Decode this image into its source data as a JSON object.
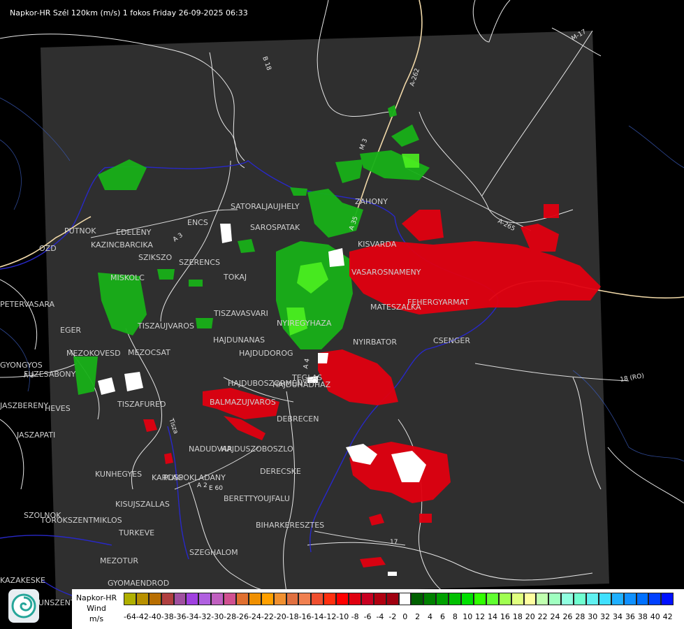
{
  "header": {
    "title": "Napkor-HR Szél 120km (m/s) 1 fokos Friday 26-09-2025 06:33"
  },
  "map": {
    "places": [
      {
        "name": "SATORALJAUJHELY"
      },
      {
        "name": "SAROSPATAK"
      },
      {
        "name": "ZAHONY"
      },
      {
        "name": "KISVARDA"
      },
      {
        "name": "VASAROSNAMENY"
      },
      {
        "name": "FEHERGYARMAT"
      },
      {
        "name": "MATESZALKA"
      },
      {
        "name": "CSENGER"
      },
      {
        "name": "NYIRBATOR"
      },
      {
        "name": "PUTNOK"
      },
      {
        "name": "EDELENY"
      },
      {
        "name": "KAZINCBARCIKA"
      },
      {
        "name": "SZIKSZO"
      },
      {
        "name": "ENCS"
      },
      {
        "name": "SZERENCS"
      },
      {
        "name": "MISKOLC"
      },
      {
        "name": "TOKAJ"
      },
      {
        "name": "OZD"
      },
      {
        "name": "PETERVASARA"
      },
      {
        "name": "EGER"
      },
      {
        "name": "MEZOKOVESD"
      },
      {
        "name": "MEZOCSAT"
      },
      {
        "name": "TISZAUJVAROS"
      },
      {
        "name": "TISZAVASVARI"
      },
      {
        "name": "HAJDUNANAS"
      },
      {
        "name": "HAJDUDOROG"
      },
      {
        "name": "HAJDUBOSZORMENY"
      },
      {
        "name": "HAJDUHADHAZ"
      },
      {
        "name": "TEGLAS"
      },
      {
        "name": "BALMAZUJVAROS"
      },
      {
        "name": "DEBRECEN"
      },
      {
        "name": "GYONGYOS"
      },
      {
        "name": "FUZESABONY"
      },
      {
        "name": "HEVES"
      },
      {
        "name": "TISZAFURED"
      },
      {
        "name": "JASZAPATI"
      },
      {
        "name": "JASZBERENY"
      },
      {
        "name": "NADUDVAR"
      },
      {
        "name": "HAJDUSZOBOSZLO"
      },
      {
        "name": "KUNHEGYES"
      },
      {
        "name": "KARCAG"
      },
      {
        "name": "PUSPOKLADANY"
      },
      {
        "name": "DERECSKE"
      },
      {
        "name": "BERETTYOUJFALU"
      },
      {
        "name": "KISUJSZALLAS"
      },
      {
        "name": "SZOLNOK"
      },
      {
        "name": "TOROKSZENTMIKLOS"
      },
      {
        "name": "TURKEVE"
      },
      {
        "name": "BIHARKERESZTES"
      },
      {
        "name": "SZEGHALOM"
      },
      {
        "name": "MEZOTUR"
      },
      {
        "name": "GYOMAENDROD"
      },
      {
        "name": "KUNSZENTMARTON"
      },
      {
        "name": "KAZAKESKE"
      },
      {
        "name": "NYIREGYHAZA"
      }
    ],
    "roads": [
      {
        "label": "B 18"
      },
      {
        "label": "A-262"
      },
      {
        "label": "A-265"
      },
      {
        "label": "M-17"
      },
      {
        "label": "18 (RO)"
      },
      {
        "label": "17"
      },
      {
        "label": "A 3"
      },
      {
        "label": "M 3"
      },
      {
        "label": "A 3"
      },
      {
        "label": "A 4"
      },
      {
        "label": "A 35"
      },
      {
        "label": "Tisza"
      },
      {
        "label": "A 2"
      },
      {
        "label": "E 60"
      }
    ]
  },
  "legend": {
    "title_line1": "Napkor-HR",
    "title_line2": "Wind",
    "title_line3": "m/s",
    "bins": [
      {
        "label": "-64",
        "color": "#b0b000"
      },
      {
        "label": "-42",
        "color": "#b89000"
      },
      {
        "label": "-40",
        "color": "#b86e00"
      },
      {
        "label": "-38",
        "color": "#b04040"
      },
      {
        "label": "-36",
        "color": "#a050a0"
      },
      {
        "label": "-34",
        "color": "#a040e0"
      },
      {
        "label": "-32",
        "color": "#b060e0"
      },
      {
        "label": "-30",
        "color": "#c060c0"
      },
      {
        "label": "-28",
        "color": "#d05090"
      },
      {
        "label": "-26",
        "color": "#e07030"
      },
      {
        "label": "-24",
        "color": "#f09000"
      },
      {
        "label": "-22",
        "color": "#ffa000"
      },
      {
        "label": "-20",
        "color": "#f09030"
      },
      {
        "label": "-18",
        "color": "#e07040"
      },
      {
        "label": "-16",
        "color": "#f08050"
      },
      {
        "label": "-14",
        "color": "#f05030"
      },
      {
        "label": "-12",
        "color": "#ff3010"
      },
      {
        "label": "-10",
        "color": "#ff0000"
      },
      {
        "label": "-8",
        "color": "#e00010"
      },
      {
        "label": "-6",
        "color": "#c80020"
      },
      {
        "label": "-4",
        "color": "#b00010"
      },
      {
        "label": "-2",
        "color": "#a00010"
      },
      {
        "label": "0",
        "color": "#ffffff"
      },
      {
        "label": "2",
        "color": "#006000"
      },
      {
        "label": "4",
        "color": "#008000"
      },
      {
        "label": "6",
        "color": "#00a000"
      },
      {
        "label": "8",
        "color": "#00c000"
      },
      {
        "label": "10",
        "color": "#00e000"
      },
      {
        "label": "12",
        "color": "#30ff00"
      },
      {
        "label": "14",
        "color": "#60ff30"
      },
      {
        "label": "16",
        "color": "#a0ff50"
      },
      {
        "label": "18",
        "color": "#e0ff80"
      },
      {
        "label": "20",
        "color": "#ffffa0"
      },
      {
        "label": "22",
        "color": "#c0ffb0"
      },
      {
        "label": "24",
        "color": "#a0ffc0"
      },
      {
        "label": "26",
        "color": "#90ffe0"
      },
      {
        "label": "28",
        "color": "#70ffd0"
      },
      {
        "label": "30",
        "color": "#60f0f0"
      },
      {
        "label": "32",
        "color": "#40e0ff"
      },
      {
        "label": "34",
        "color": "#20b0ff"
      },
      {
        "label": "36",
        "color": "#1090ff"
      },
      {
        "label": "38",
        "color": "#0070ff"
      },
      {
        "label": "40",
        "color": "#0040ff"
      },
      {
        "label": "42",
        "color": "#0010ff"
      }
    ]
  },
  "colors": {
    "background": "#000000",
    "radar_area": "#2e2e2e",
    "border_line": "#2020c0",
    "outline": "#ffffff"
  }
}
